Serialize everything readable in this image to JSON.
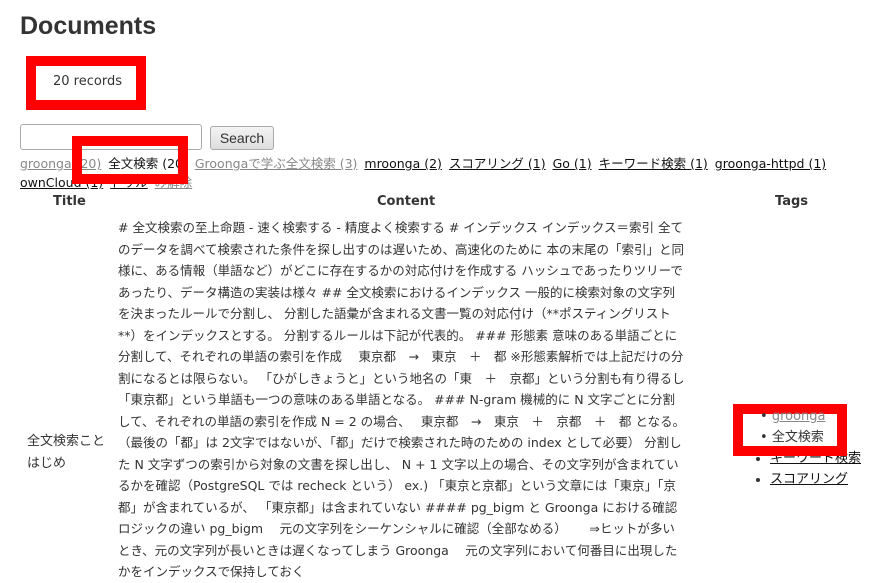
{
  "page": {
    "title": "Documents",
    "records": "20 records"
  },
  "search": {
    "value": "",
    "button": "Search"
  },
  "tag_filter": [
    {
      "label": "groonga (20)",
      "style": "visited"
    },
    {
      "label": "全文検索 (20)",
      "style": "current"
    },
    {
      "label": "Groongaで学ぶ全文検索 (3)",
      "style": "visited"
    },
    {
      "label": "mroonga (2)",
      "style": "link"
    },
    {
      "label": "スコアリング (1)",
      "style": "link"
    },
    {
      "label": "Go (1)",
      "style": "link"
    },
    {
      "label": "キーワード検索 (1)",
      "style": "link"
    },
    {
      "label": "groonga-httpd (1)",
      "style": "link"
    },
    {
      "label": "ownCloud (1)",
      "style": "link"
    },
    {
      "label": "ドリル",
      "style": "link"
    }
  ],
  "clear_filter": "み解除",
  "table": {
    "headers": [
      "Title",
      "Content",
      "Tags"
    ],
    "rows": [
      {
        "title": "全文検索ことはじめ",
        "content": "# 全文検索の至上命題 - 速く検索する - 精度よく検索する # インデックス インデックス＝索引 全てのデータを調べて検索された条件を探し出すのは遅いため、高速化のために 本の末尾の「索引」と同様に、ある情報（単語など）がどこに存在するかの対応付けを作成する ハッシュであったりツリーであったり、データ構造の実装は様々 ## 全文検索におけるインデックス 一般的に検索対象の文字列を決まったルールで分割し、 分割した語彙が含まれる文書一覧の対応付け（**ポスティングリスト**）をインデックスとする。 分割するルールは下記が代表的。 ### 形態素 意味のある単語ごとに分割して、それぞれの単語の索引を作成　 東京都　→　東京　＋　都 ※形態素解析では上記だけの分割になるとは限らない。 「ひがしきょうと」という地名の「東　＋　京都」という分割も有り得るし「東京都」という単語も一つの意味のある単語となる。 ### N-gram 機械的に N 文字ごとに分割して、それぞれの単語の索引を作成 N = 2 の場合、　 東京都　→　東京　＋　京都　＋　都 となる。（最後の「都」は 2文字ではないが、「都」だけで検索された時のための index として必要） 分割した N 文字ずつの索引から対象の文書を探し出し、 N + 1 文字以上の場合、その文字列が含まれているかを確認（PostgreSQL では recheck という） ex.) 「東京と京都」という文章には「東京」「京都」が含まれているが、 「東京都」は含まれていない #### pg_bigm と Groonga における確認ロジックの違い pg_bigm　 元の文字列をシーケンシャルに確認（全部なめる）　　 ⇒ヒットが多いとき、元の文字列が長いときは遅くなってしまう Groonga　 元の文字列において何番目に出現したかをインデックスで保持しておく",
        "tags": [
          {
            "label": "groonga",
            "style": "visited"
          },
          {
            "label": "全文検索",
            "style": "plain"
          },
          {
            "label": "キーワード検索",
            "style": "link"
          },
          {
            "label": "スコアリング",
            "style": "link"
          }
        ]
      }
    ]
  },
  "colors": {
    "annotation": "#ff0000",
    "visited_link": "#888888"
  }
}
